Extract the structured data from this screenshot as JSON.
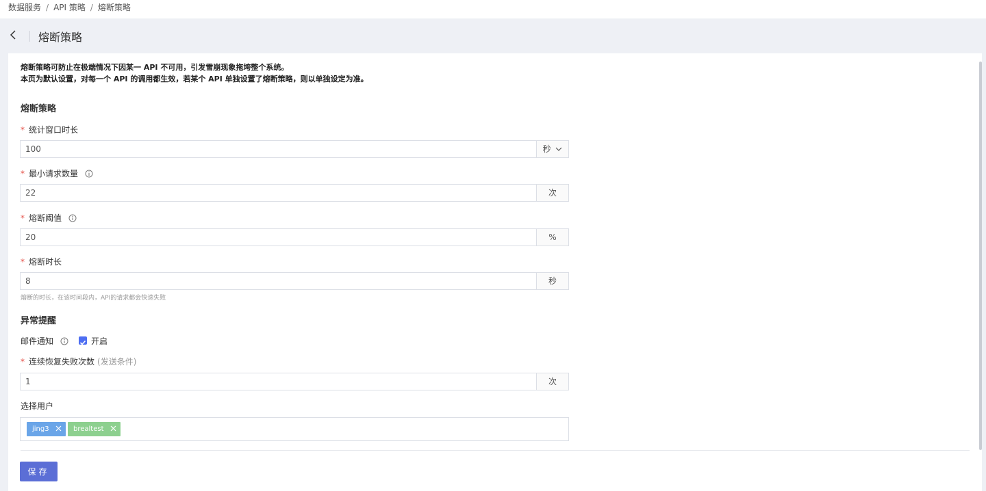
{
  "breadcrumb": {
    "items": [
      "数据服务",
      "API 策略",
      "熔断策略"
    ],
    "separator": "/"
  },
  "header": {
    "title": "熔断策略",
    "back_icon": "chevron-left-icon"
  },
  "notice": {
    "line1": "熔断策略可防止在极端情况下因某一 API 不可用，引发雪崩现象拖垮整个系统。",
    "line2": "本页为默认设置，对每一个 API 的调用都生效，若某个 API 单独设置了熔断策略，则以单独设定为准。"
  },
  "circuit": {
    "section_title": "熔断策略",
    "window": {
      "label": "统计窗口时长",
      "value": "100",
      "unit": "秒"
    },
    "min_requests": {
      "label": "最小请求数量",
      "value": "22",
      "unit": "次"
    },
    "threshold": {
      "label": "熔断阈值",
      "value": "20",
      "unit": "%"
    },
    "duration": {
      "label": "熔断时长",
      "value": "8",
      "unit": "秒",
      "hint": "熔断的时长，在该时间段内，API的请求都会快速失败"
    }
  },
  "alert": {
    "section_title": "异常提醒",
    "email_label": "邮件通知",
    "email_enabled": true,
    "email_checkbox_label": "开启",
    "failures": {
      "label": "连续恢复失败次数",
      "sub": "(发送条件)",
      "value": "1",
      "unit": "次"
    },
    "users_label": "选择用户",
    "users": [
      {
        "name": "jing3",
        "color": "#6aa5e8"
      },
      {
        "name": "brealtest",
        "color": "#8dd08f"
      }
    ]
  },
  "required_mark": "*",
  "save_label": "保存",
  "colors": {
    "accent": "#5b6ed6",
    "required": "#e5534b",
    "checkbox": "#4e6ef2"
  }
}
